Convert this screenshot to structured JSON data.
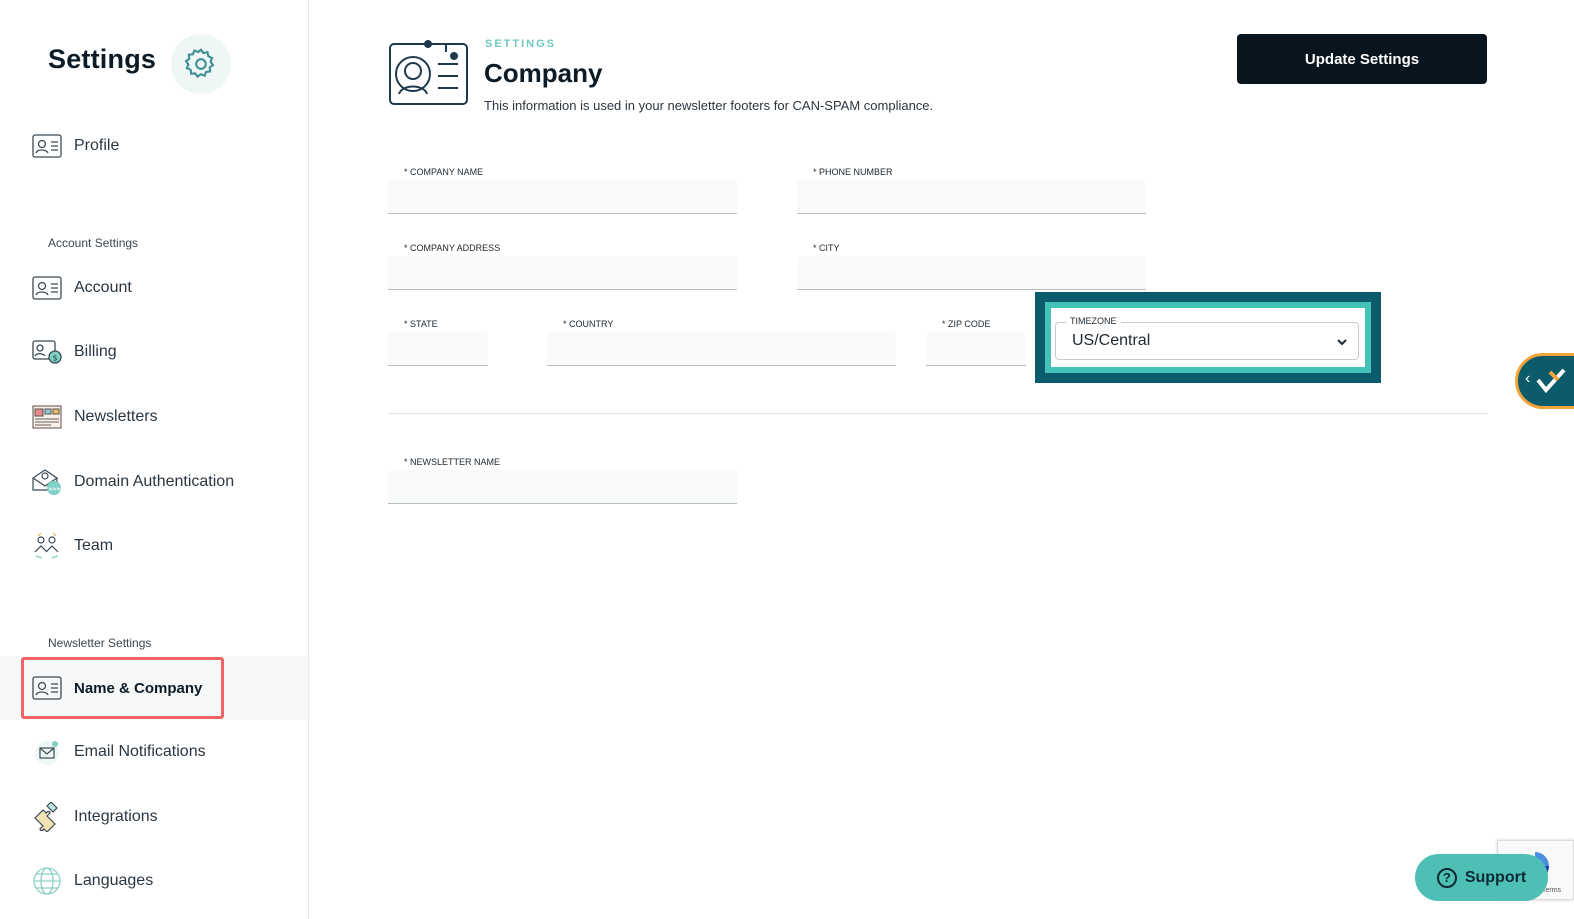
{
  "sidebar": {
    "title": "Settings",
    "profile_label": "Profile",
    "account_section": "Account Settings",
    "account_items": [
      {
        "label": "Account"
      },
      {
        "label": "Billing"
      },
      {
        "label": "Newsletters"
      },
      {
        "label": "Domain Authentication"
      },
      {
        "label": "Team"
      }
    ],
    "newsletter_section": "Newsletter Settings",
    "newsletter_items": [
      {
        "label": "Name & Company"
      },
      {
        "label": "Email Notifications"
      },
      {
        "label": "Integrations"
      },
      {
        "label": "Languages"
      }
    ],
    "active_item": "Name & Company"
  },
  "header": {
    "kicker": "SETTINGS",
    "title": "Company",
    "subtitle": "This information is used in your newsletter footers for CAN-SPAM compliance.",
    "update_button": "Update Settings"
  },
  "form": {
    "company_name": {
      "label": "* COMPANY NAME",
      "value": ""
    },
    "phone_number": {
      "label": "* PHONE NUMBER",
      "value": ""
    },
    "company_address": {
      "label": "* COMPANY ADDRESS",
      "value": ""
    },
    "city": {
      "label": "* CITY",
      "value": ""
    },
    "state": {
      "label": "* STATE",
      "value": ""
    },
    "country": {
      "label": "* COUNTRY",
      "value": ""
    },
    "zip_code": {
      "label": "* ZIP CODE",
      "value": ""
    },
    "timezone": {
      "label": "TIMEZONE",
      "value": "US/Central"
    },
    "newsletter_name": {
      "label": "* NEWSLETTER NAME",
      "value": ""
    }
  },
  "widgets": {
    "support_label": "Support",
    "recaptcha_terms": "Terms"
  },
  "colors": {
    "accent": "#6fcac0",
    "highlight_red": "#ef6464",
    "timezone_frame_outer": "#0a5c6c",
    "timezone_frame_inner": "#45c2b7",
    "primary_button": "#08141e",
    "support_button": "#4ebfb4"
  },
  "icons": {
    "settings": "gear-icon",
    "profile": "id-card-icon",
    "account": "id-card-icon",
    "billing": "billing-icon",
    "newsletters": "newsletter-icon",
    "domain": "domain-mail-icon",
    "team": "team-icon",
    "name_company": "id-card-icon",
    "email_notifications": "email-notification-icon",
    "integrations": "puzzle-icon",
    "languages": "globe-icon"
  }
}
